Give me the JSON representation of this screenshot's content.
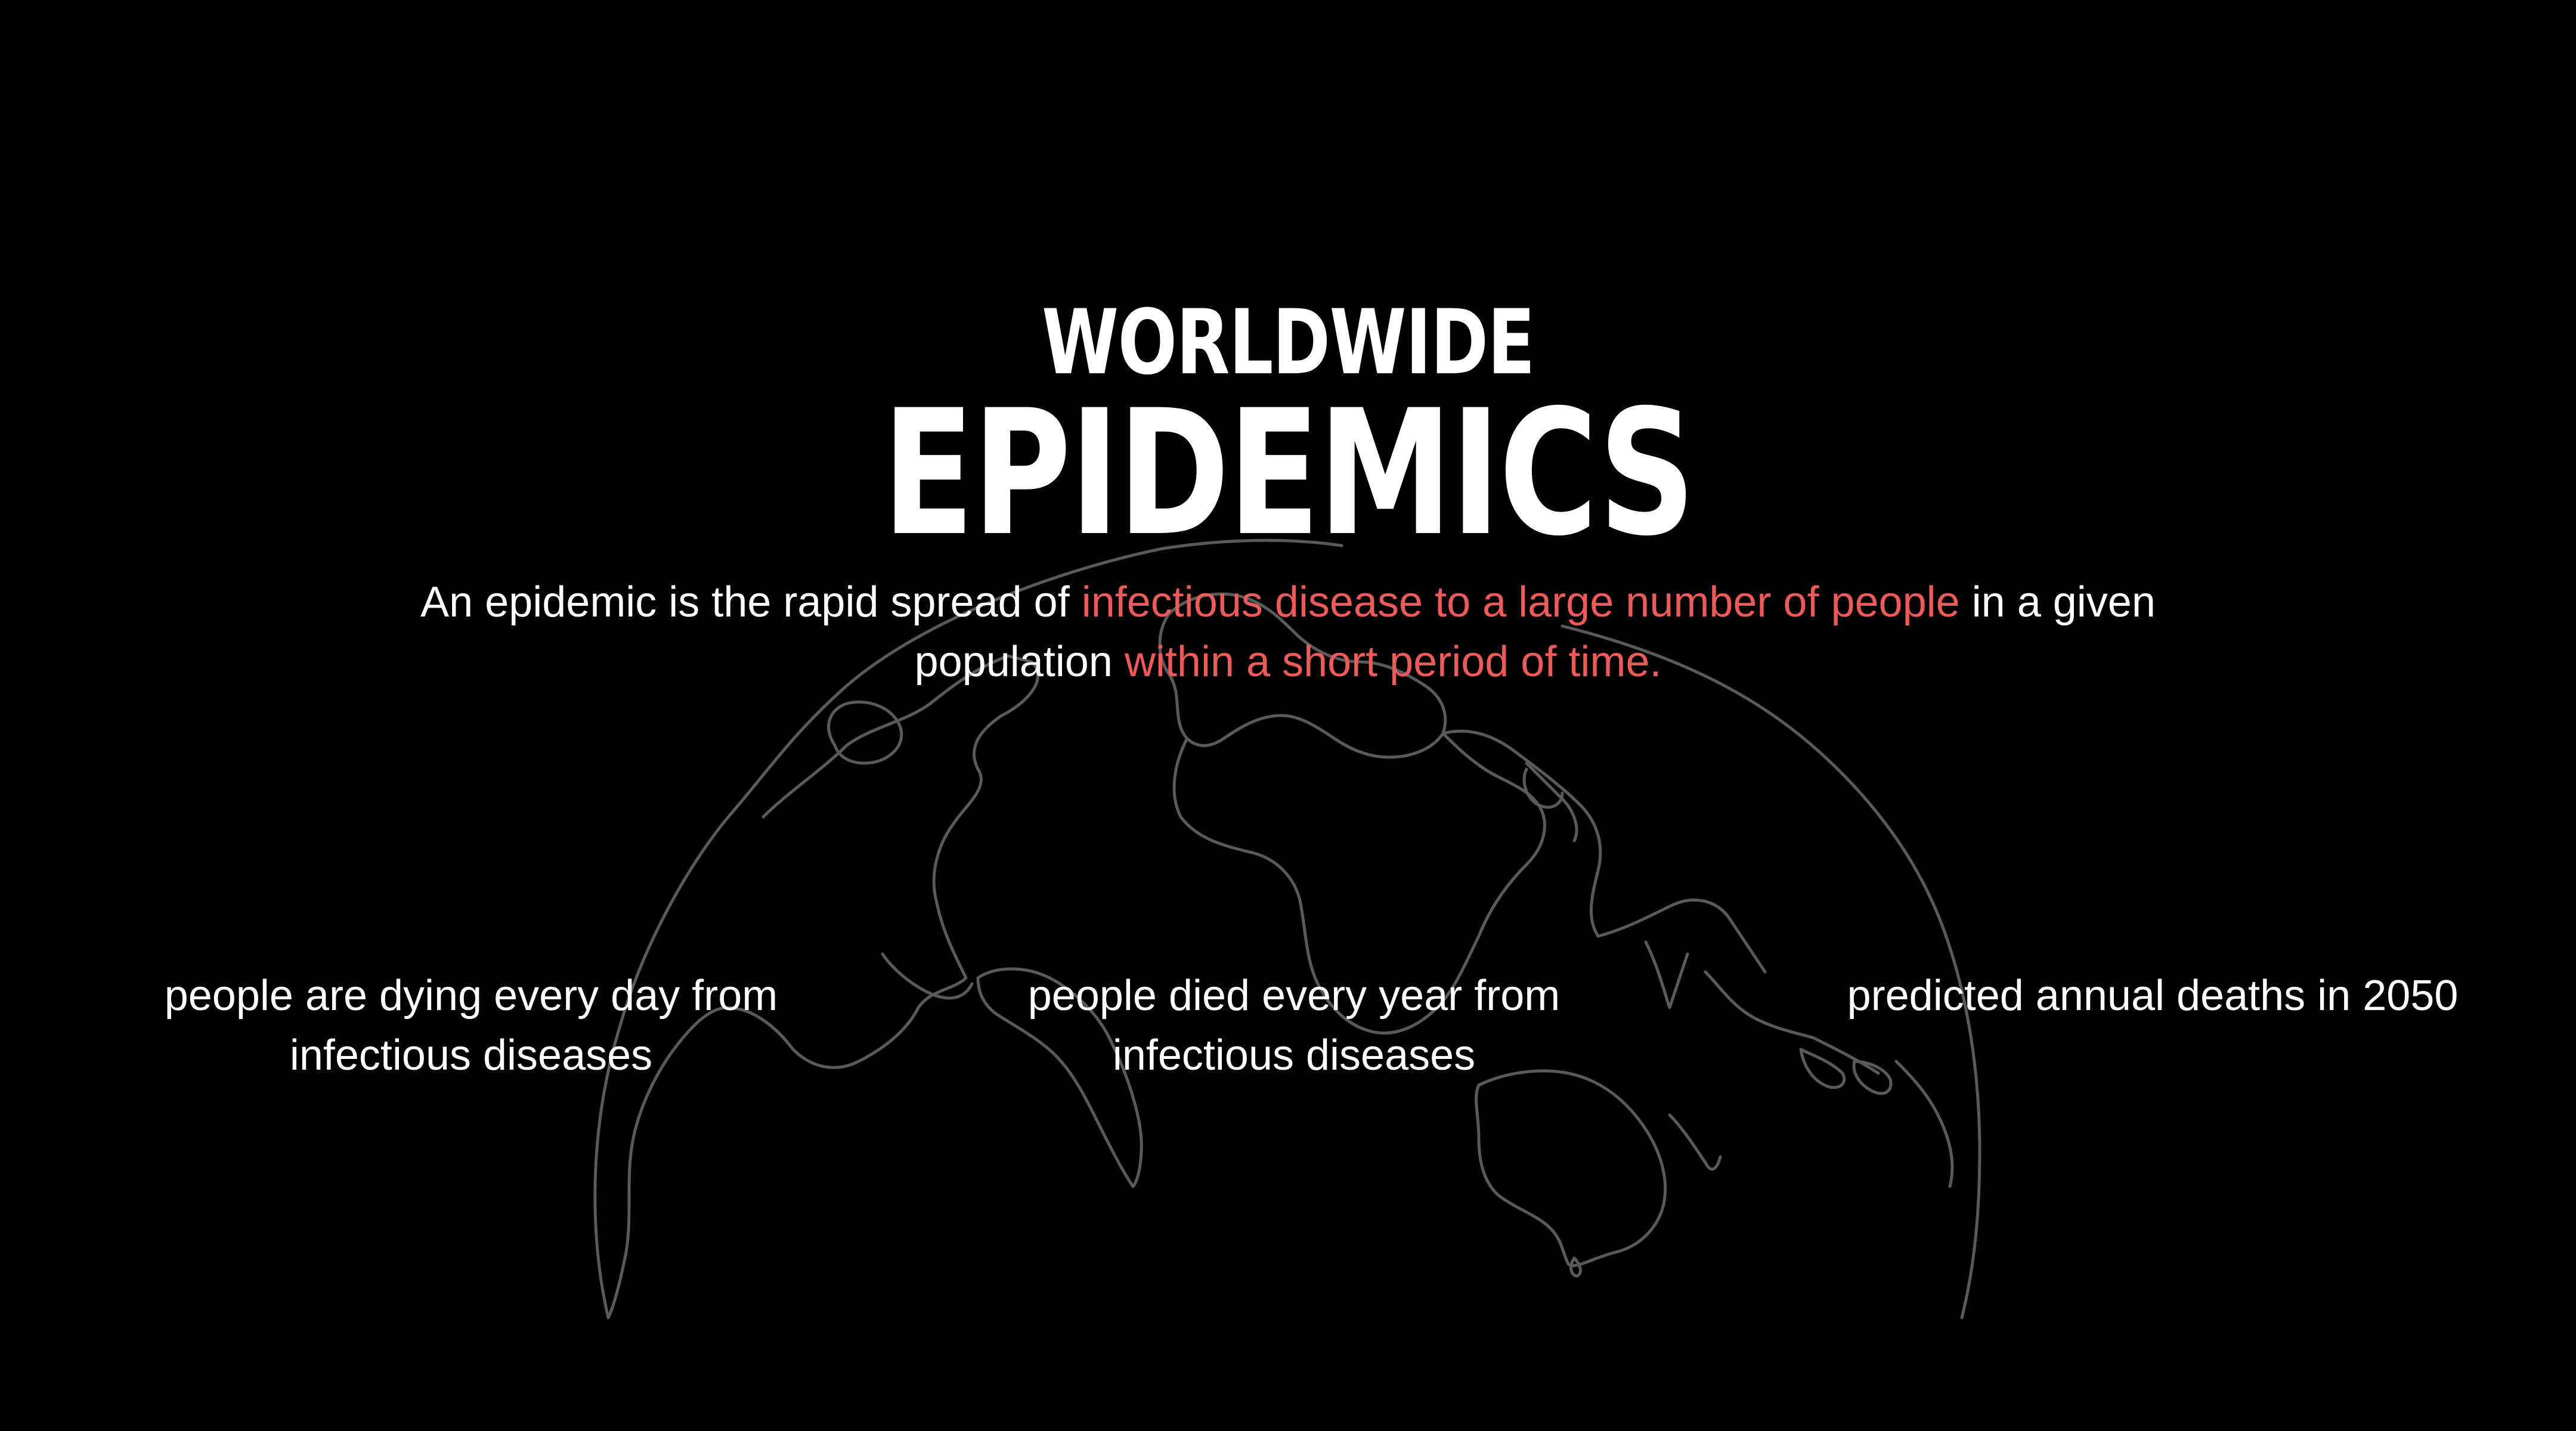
{
  "title": {
    "top": "WORLDWIDE",
    "main": "EPIDEMICS"
  },
  "definition": {
    "part1": "An epidemic is the rapid spread of ",
    "highlight1": "infectious disease to a large number of people",
    "part2": " in a given population ",
    "highlight2": "within a short period of time."
  },
  "stats": [
    {
      "caption": "people are dying every day from infectious diseases"
    },
    {
      "caption": "people died every year from infectious diseases"
    },
    {
      "caption": "predicted annual deaths in 2050"
    }
  ],
  "colors": {
    "background": "#000000",
    "text": "#ffffff",
    "accent": "#ec5a5a",
    "globe_outline": "#5a5a5a"
  }
}
